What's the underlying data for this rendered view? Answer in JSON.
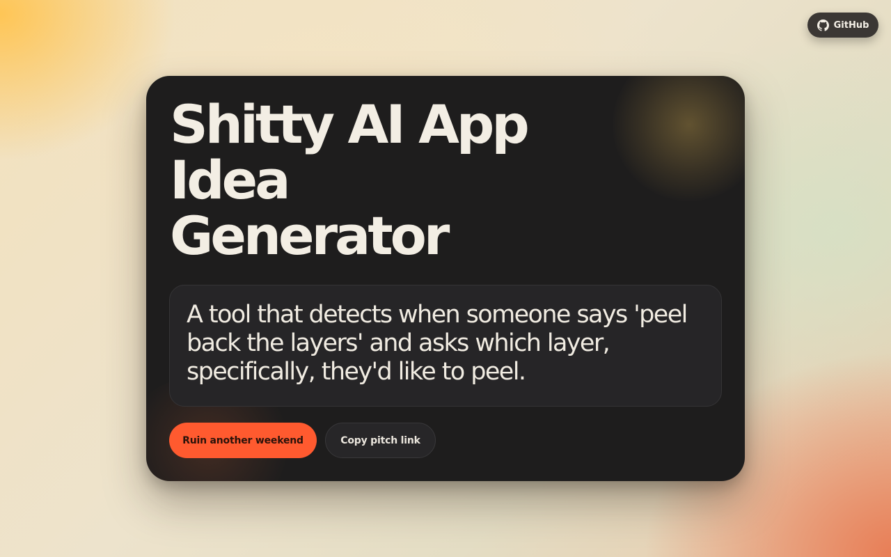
{
  "header": {
    "github_label": "GitHub",
    "github_icon": "github-icon"
  },
  "card": {
    "title_lines": [
      "Shitty AI App",
      "Idea",
      "Generator"
    ],
    "idea_text": "A tool that detects when someone says 'peel back the layers' and asks which layer, specifically, they'd like to peel.",
    "primary_button_label": "Ruin another weekend",
    "secondary_button_label": "Copy pitch link"
  },
  "colors": {
    "accent": "#ff5a2f",
    "card_background": "#1e1d1d",
    "text_light": "#f3eee4"
  }
}
